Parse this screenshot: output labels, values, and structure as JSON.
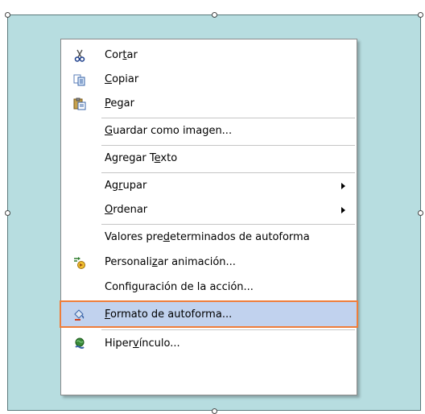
{
  "menu": {
    "items": [
      {
        "id": "cortar",
        "pre": "Cor",
        "acc": "t",
        "post": "ar",
        "icon": "scissors-icon",
        "submenu": false
      },
      {
        "id": "copiar",
        "pre": "",
        "acc": "C",
        "post": "opiar",
        "icon": "copy-icon",
        "submenu": false
      },
      {
        "id": "pegar",
        "pre": "",
        "acc": "P",
        "post": "egar",
        "icon": "paste-icon",
        "submenu": false
      },
      {
        "id": "guardar-como-imagen",
        "pre": "",
        "acc": "G",
        "post": "uardar como imagen...",
        "icon": null,
        "submenu": false
      },
      {
        "id": "agregar-texto",
        "pre": "Agregar T",
        "acc": "e",
        "post": "xto",
        "icon": null,
        "submenu": false
      },
      {
        "id": "agrupar",
        "pre": "Ag",
        "acc": "r",
        "post": "upar",
        "icon": null,
        "submenu": true
      },
      {
        "id": "ordenar",
        "pre": "",
        "acc": "O",
        "post": "rdenar",
        "icon": null,
        "submenu": true
      },
      {
        "id": "valores-predeterminados",
        "pre": "Valores pre",
        "acc": "d",
        "post": "eterminados de autoforma",
        "icon": null,
        "submenu": false
      },
      {
        "id": "personalizar-animacion",
        "pre": "Personali",
        "acc": "z",
        "post": "ar animación...",
        "icon": "animation-icon",
        "submenu": false
      },
      {
        "id": "configuracion-accion",
        "pre": "Confi",
        "acc": "g",
        "post": "uración de la acción...",
        "icon": null,
        "submenu": false
      },
      {
        "id": "formato-autoforma",
        "pre": "",
        "acc": "F",
        "post": "ormato de autoforma...",
        "icon": "format-shape-icon",
        "submenu": false,
        "selected": true
      },
      {
        "id": "hipervinculo",
        "pre": "Hiper",
        "acc": "v",
        "post": "ínculo...",
        "icon": "hyperlink-icon",
        "submenu": false
      }
    ]
  },
  "colors": {
    "shape_fill": "#b7dde0",
    "highlight": "#c1d2ee",
    "highlight_border": "#ef7d3a"
  }
}
